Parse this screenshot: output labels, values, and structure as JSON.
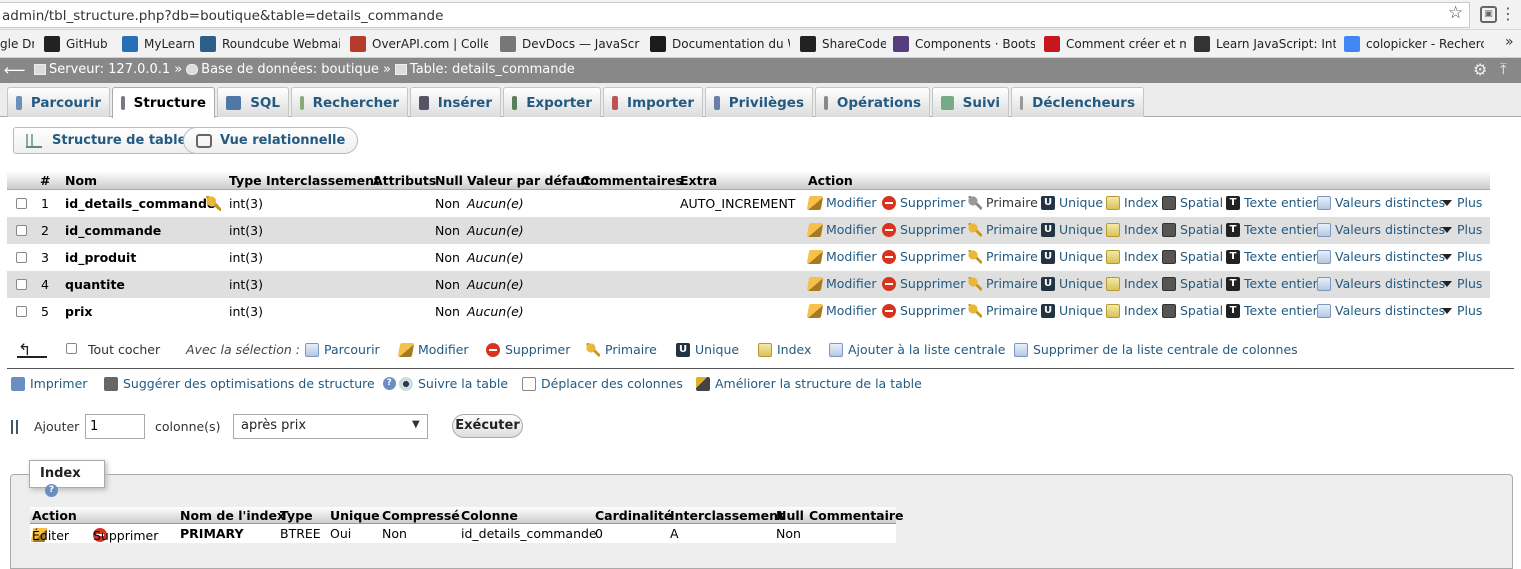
{
  "browser": {
    "url": "admin/tbl_structure.php?db=boutique&table=details_commande",
    "bookmarks": [
      {
        "label": "gle Dr",
        "icon": "google-drive-icon",
        "color": "#4a8af4"
      },
      {
        "label": "GitHub",
        "icon": "github-icon",
        "color": "#222222"
      },
      {
        "label": "MyLearn",
        "icon": "mylearn-icon",
        "color": "#2a6fb5"
      },
      {
        "label": "Roundcube Webmail",
        "icon": "roundcube-icon",
        "color": "#2b5f8a"
      },
      {
        "label": "OverAPI.com | Collect",
        "icon": "overapi-icon",
        "color": "#b53b2d"
      },
      {
        "label": "DevDocs — JavaScrip",
        "icon": "devdocs-icon",
        "color": "#777777"
      },
      {
        "label": "Documentation du W",
        "icon": "mdn-icon",
        "color": "#1b1b1b"
      },
      {
        "label": "ShareCode",
        "icon": "sharecode-icon",
        "color": "#222222"
      },
      {
        "label": "Components · Bootstr",
        "icon": "bootstrap-icon",
        "color": "#563d7c"
      },
      {
        "label": "Comment créer et ma",
        "icon": "jquery-icon",
        "color": "#c8161d"
      },
      {
        "label": "Learn JavaScript: Intr",
        "icon": "codecademy-icon",
        "color": "#333333"
      },
      {
        "label": "colopicker - Recherch",
        "icon": "google-icon",
        "color": "#4285f4"
      }
    ],
    "more": "»"
  },
  "breadcrumb": {
    "server_label": "Serveur: 127.0.0.1",
    "db_label": "Base de données: boutique",
    "table_label": "Table: details_commande",
    "sep": "»"
  },
  "tabs": [
    {
      "label": "Parcourir",
      "icon": "browse-icon",
      "active": false
    },
    {
      "label": "Structure",
      "icon": "structure-icon",
      "active": true
    },
    {
      "label": "SQL",
      "icon": "sql-icon",
      "active": false
    },
    {
      "label": "Rechercher",
      "icon": "search-icon",
      "active": false
    },
    {
      "label": "Insérer",
      "icon": "insert-icon",
      "active": false
    },
    {
      "label": "Exporter",
      "icon": "export-icon",
      "active": false
    },
    {
      "label": "Importer",
      "icon": "import-icon",
      "active": false
    },
    {
      "label": "Privilèges",
      "icon": "privileges-icon",
      "active": false
    },
    {
      "label": "Opérations",
      "icon": "operations-icon",
      "active": false
    },
    {
      "label": "Suivi",
      "icon": "tracking-icon",
      "active": false
    },
    {
      "label": "Déclencheurs",
      "icon": "triggers-icon",
      "active": false
    }
  ],
  "subnav": {
    "structure_label": "Structure de table",
    "relational_label": "Vue relationnelle"
  },
  "columns_table": {
    "headers": {
      "num": "#",
      "name": "Nom",
      "type": "Type",
      "collation": "Interclassement",
      "attributes": "Attributs",
      "null": "Null",
      "default": "Valeur par défaut",
      "comments": "Commentaires",
      "extra": "Extra",
      "action": "Action"
    },
    "rows": [
      {
        "num": "1",
        "name": "id_details_commande",
        "type": "int(3)",
        "null": "Non",
        "default": "Aucun(e)",
        "extra": "AUTO_INCREMENT",
        "primary_key": true
      },
      {
        "num": "2",
        "name": "id_commande",
        "type": "int(3)",
        "null": "Non",
        "default": "Aucun(e)",
        "extra": "",
        "primary_key": false
      },
      {
        "num": "3",
        "name": "id_produit",
        "type": "int(3)",
        "null": "Non",
        "default": "Aucun(e)",
        "extra": "",
        "primary_key": false
      },
      {
        "num": "4",
        "name": "quantite",
        "type": "int(3)",
        "null": "Non",
        "default": "Aucun(e)",
        "extra": "",
        "primary_key": false
      },
      {
        "num": "5",
        "name": "prix",
        "type": "int(3)",
        "null": "Non",
        "default": "Aucun(e)",
        "extra": "",
        "primary_key": false
      }
    ],
    "actions": {
      "modify": "Modifier",
      "delete": "Supprimer",
      "primary": "Primaire",
      "unique": "Unique",
      "index": "Index",
      "spatial": "Spatial",
      "fulltext": "Texte entier",
      "distinct": "Valeurs distinctes",
      "more": "Plus"
    }
  },
  "bulk": {
    "check_all": "Tout cocher",
    "with_selected": "Avec la sélection :",
    "browse": "Parcourir",
    "modify": "Modifier",
    "delete": "Supprimer",
    "primary": "Primaire",
    "unique": "Unique",
    "index": "Index",
    "add_central": "Ajouter à la liste centrale",
    "remove_central": "Supprimer de la liste centrale de colonnes"
  },
  "tools": {
    "print": "Imprimer",
    "suggest": "Suggérer des optimisations de structure",
    "track": "Suivre la table",
    "move": "Déplacer des colonnes",
    "improve": "Améliorer la structure de la table"
  },
  "add_columns": {
    "label": "Ajouter",
    "count": "1",
    "unit": "colonne(s)",
    "position": "après prix",
    "execute": "Exécuter"
  },
  "index_section": {
    "legend": "Index",
    "headers": {
      "action": "Action",
      "name": "Nom de l'index",
      "type": "Type",
      "unique": "Unique",
      "packed": "Compressé",
      "column": "Colonne",
      "cardinality": "Cardinalité",
      "collation": "Interclassement",
      "null": "Null",
      "comment": "Commentaire"
    },
    "row": {
      "edit": "Éditer",
      "delete": "Supprimer",
      "name": "PRIMARY",
      "type": "BTREE",
      "unique": "Oui",
      "packed": "Non",
      "column": "id_details_commande",
      "cardinality": "0",
      "collation": "A",
      "null": "Non",
      "comment": ""
    }
  },
  "colors": {
    "link": "#235a81",
    "topbar": "#888888",
    "row_even": "#dfdfdf",
    "delete_icon": "#d9321f",
    "key_icon": "#e8b83a"
  }
}
